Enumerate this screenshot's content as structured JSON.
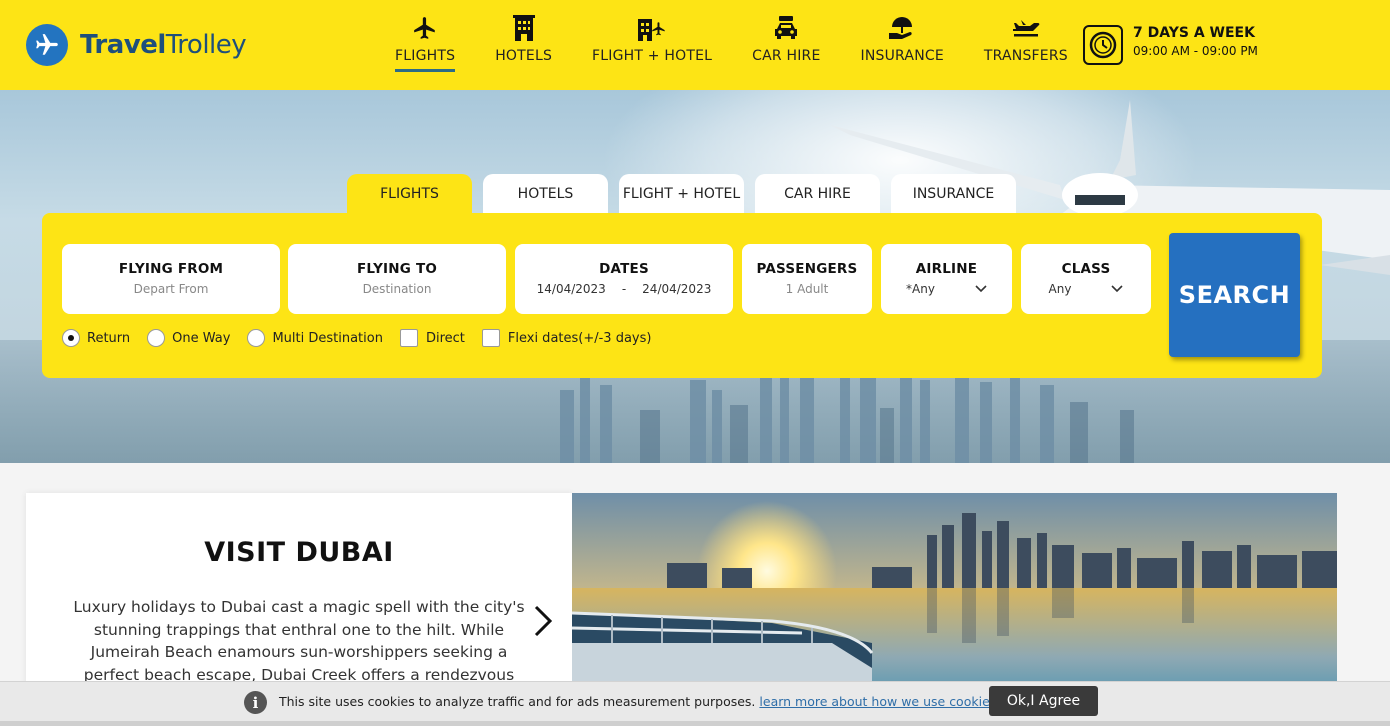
{
  "brand": {
    "name_bold": "Travel",
    "name_light": "Trolley",
    "color": "#2374c0"
  },
  "nav": {
    "items": [
      {
        "label": "FLIGHTS",
        "icon": "airplane-icon",
        "active": true
      },
      {
        "label": "HOTELS",
        "icon": "hotel-building-icon"
      },
      {
        "label": "FLIGHT + HOTEL",
        "icon": "flight-hotel-icon"
      },
      {
        "label": "CAR HIRE",
        "icon": "car-icon"
      },
      {
        "label": "INSURANCE",
        "icon": "umbrella-hand-icon"
      },
      {
        "label": "TRANSFERS",
        "icon": "transfer-plane-icon"
      }
    ]
  },
  "hours": {
    "title": "7 DAYS A WEEK",
    "time": "09:00 AM - 09:00 PM",
    "icon": "clock-icon"
  },
  "search": {
    "tabs": [
      "FLIGHTS",
      "HOTELS",
      "FLIGHT + HOTEL",
      "CAR HIRE",
      "INSURANCE"
    ],
    "active_tab": "FLIGHTS",
    "fields": {
      "from": {
        "label": "FLYING FROM",
        "placeholder": "Depart From"
      },
      "to": {
        "label": "FLYING TO",
        "placeholder": "Destination"
      },
      "dates": {
        "label": "DATES",
        "start": "14/04/2023",
        "separator": "-",
        "end": "24/04/2023"
      },
      "passengers": {
        "label": "PASSENGERS",
        "value": "1 Adult"
      },
      "airline": {
        "label": "AIRLINE",
        "value": "*Any"
      },
      "class": {
        "label": "CLASS",
        "value": "Any"
      }
    },
    "button": "SEARCH",
    "trip_types": [
      {
        "label": "Return",
        "selected": true
      },
      {
        "label": "One Way",
        "selected": false
      },
      {
        "label": "Multi Destination",
        "selected": false
      }
    ],
    "checkboxes": [
      {
        "label": "Direct",
        "checked": false
      },
      {
        "label": "Flexi dates(+/-3 days)",
        "checked": false
      }
    ]
  },
  "feature": {
    "title": "VISIT DUBAI",
    "text": "Luxury holidays to Dubai cast a magic spell with the city's stunning trappings that enthral one to the hilt. While Jumeirah Beach enamours sun-worshippers seeking a perfect beach escape, Dubai Creek offers a rendezvous with"
  },
  "cookie": {
    "text": "This site uses cookies to analyze traffic and for ads measurement purposes.",
    "link": "learn more about how we use cookies.",
    "button": "Ok,I Agree"
  },
  "colors": {
    "header_yellow": "#fde415",
    "search_blue": "#2570c0",
    "nav_underline": "#2c6b86"
  }
}
